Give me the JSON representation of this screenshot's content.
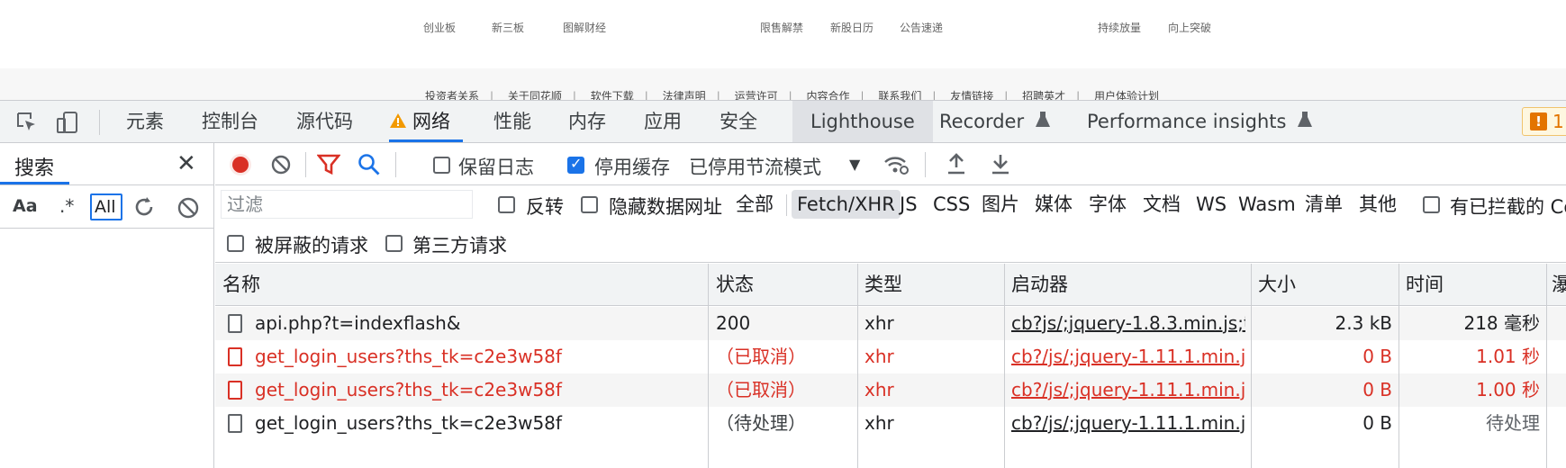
{
  "webpage": {
    "top_links": [
      {
        "label": "创业板"
      },
      {
        "label": "新三板"
      },
      {
        "label": "图解财经"
      },
      {
        "label": "限售解禁"
      },
      {
        "label": "新股日历"
      },
      {
        "label": "公告速递"
      },
      {
        "label": "持续放量"
      },
      {
        "label": "向上突破"
      }
    ],
    "footer_links": [
      "投资者关系",
      "关于同花顺",
      "软件下载",
      "法律声明",
      "运营许可",
      "内容合作",
      "联系我们",
      "友情链接",
      "招聘英才",
      "用户体验计划"
    ]
  },
  "devtools": {
    "tabs": {
      "elements": "元素",
      "console": "控制台",
      "sources": "源代码",
      "network": "网络",
      "performance": "性能",
      "memory": "内存",
      "application": "应用",
      "security": "安全",
      "lighthouse": "Lighthouse",
      "recorder": "Recorder",
      "perf_insights": "Performance insights"
    },
    "issues_count": "1",
    "search_pane": {
      "title": "搜索",
      "case_label": "Aa",
      "regex_label": ".*",
      "input_value": "All"
    },
    "network": {
      "preserve_log": "保留日志",
      "disable_cache": "停用缓存",
      "throttling": "已停用节流模式",
      "filter_placeholder": "过滤",
      "invert": "反转",
      "hide_data_urls": "隐藏数据网址",
      "types": {
        "all": "全部",
        "fetch_xhr": "Fetch/XHR",
        "js": "JS",
        "css": "CSS",
        "img": "图片",
        "media": "媒体",
        "font": "字体",
        "doc": "文档",
        "ws": "WS",
        "wasm": "Wasm",
        "manifest": "清单",
        "other": "其他"
      },
      "blocked_cookies": "有已拦截的 Co",
      "blocked_requests": "被屏蔽的请求",
      "third_party": "第三方请求",
      "columns": {
        "name": "名称",
        "status": "状态",
        "type": "类型",
        "initiator": "启动器",
        "size": "大小",
        "time": "时间",
        "waterfall": "瀑"
      },
      "rows": [
        {
          "name": "api.php?t=indexflash&",
          "status": "200",
          "type": "xhr",
          "initiator": "cb?js/;jquery-1.8.3.min.js;t...",
          "size": "2.3 kB",
          "time": "218 毫秒"
        },
        {
          "name": "get_login_users?ths_tk=c2e3w58f",
          "status": "（已取消）",
          "type": "xhr",
          "initiator": "cb?/js/;jquery-1.11.1.min.j...",
          "size": "0 B",
          "time": "1.01 秒"
        },
        {
          "name": "get_login_users?ths_tk=c2e3w58f",
          "status": "（已取消）",
          "type": "xhr",
          "initiator": "cb?/js/;jquery-1.11.1.min.j...",
          "size": "0 B",
          "time": "1.00 秒"
        },
        {
          "name": "get_login_users?ths_tk=c2e3w58f",
          "status": "（待处理）",
          "type": "xhr",
          "initiator": "cb?/js/;jquery-1.11.1.min.j...",
          "size": "0 B",
          "time": "待处理"
        }
      ]
    }
  }
}
